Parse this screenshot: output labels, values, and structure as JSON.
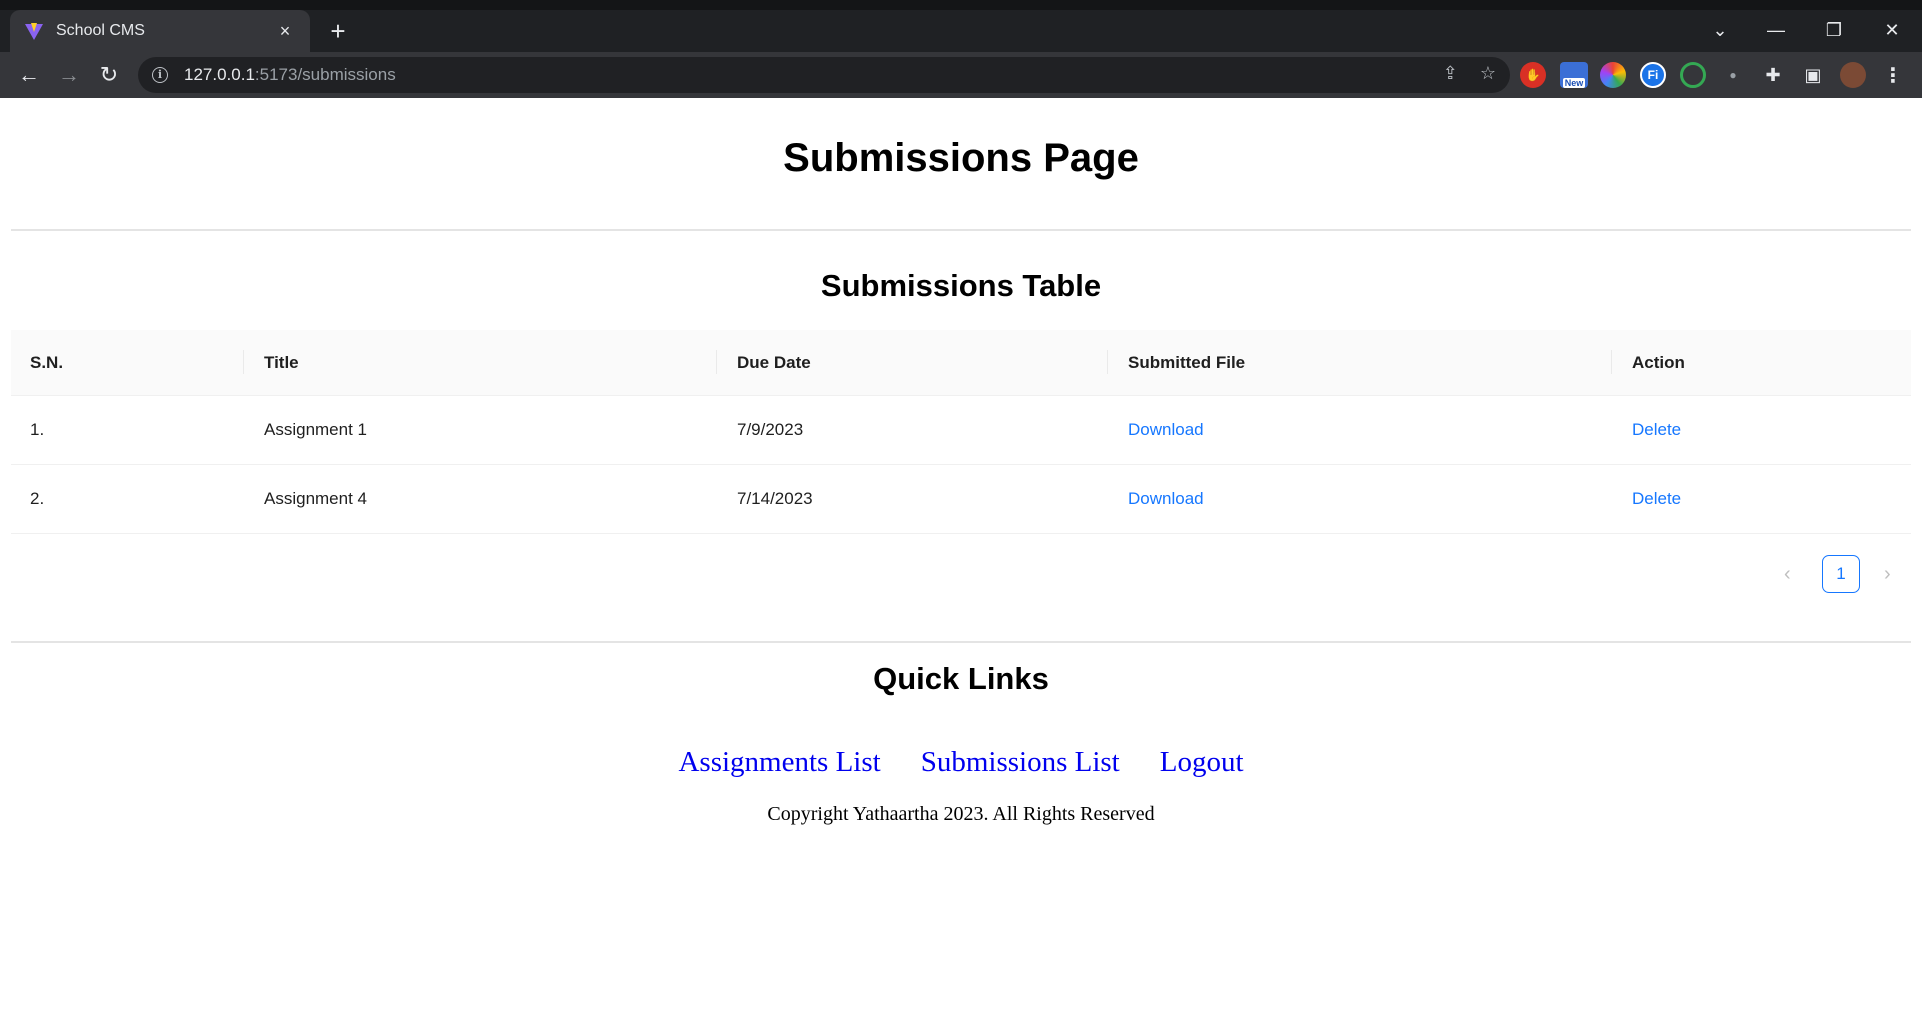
{
  "browser": {
    "tab_title": "School CMS",
    "tab_close": "×",
    "new_tab": "+",
    "url_host": "127.0.0.1",
    "url_rest": ":5173/submissions",
    "extension_badge_new": "New"
  },
  "page": {
    "title": "Submissions Page",
    "table_section_title": "Submissions Table",
    "table": {
      "columns": [
        "S.N.",
        "Title",
        "Due Date",
        "Submitted File",
        "Action"
      ],
      "rows": [
        {
          "sn": "1.",
          "title": "Assignment 1",
          "due_date": "7/9/2023",
          "file": "Download",
          "action": "Delete"
        },
        {
          "sn": "2.",
          "title": "Assignment 4",
          "due_date": "7/14/2023",
          "file": "Download",
          "action": "Delete"
        }
      ]
    },
    "pagination": {
      "current_page": "1",
      "prev": "‹",
      "next": "›"
    },
    "quick_links_title": "Quick Links",
    "quick_links": [
      "Assignments List",
      "Submissions List",
      "Logout"
    ],
    "copyright": "Copyright Yathaartha 2023. All Rights Reserved"
  },
  "colors": {
    "link": "#1677ff",
    "quick_link": "#0000ee",
    "chrome_dark": "#35363a"
  }
}
